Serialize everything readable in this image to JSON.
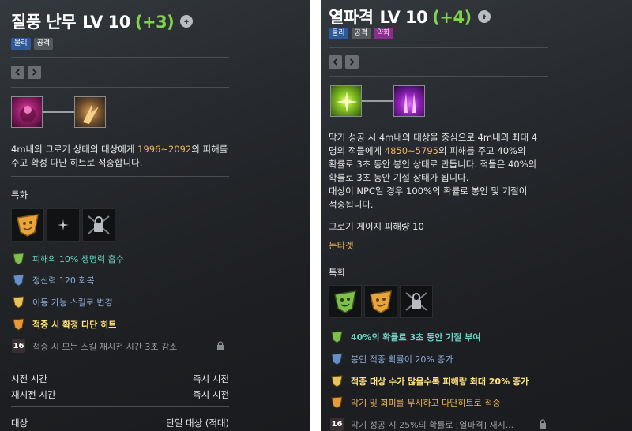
{
  "colors": {
    "accent_orange": "#f0b457",
    "bonus_green": "#7fd34f",
    "effect_cyan": "#6fd1c4",
    "effect_blue": "#8ea9d6",
    "effect_yellow": "#ffe27a",
    "effect_orange": "#f0b457"
  },
  "left": {
    "title": "질풍 난무",
    "level": "LV 10",
    "bonus": "(+3)",
    "tags": [
      "물리",
      "공격"
    ],
    "tripod_icons": [
      "crimson-skill-icon",
      "golden-flurry-icon"
    ],
    "desc": {
      "l1_pre": "4m내의 그로기 상태의 대상에게 ",
      "l1_val": "1996~2092",
      "l1_post": "의 피해를",
      "l2": "주고 확정 다단 히트로 적중합니다."
    },
    "spec_label": "특화",
    "gems": [
      "golden-mask-gem-icon",
      "sparkle-slot-icon",
      "locked-slot-icon"
    ],
    "effects": [
      {
        "text": "피해의 10% 생명력 흡수",
        "icon": "green-tier-icon"
      },
      {
        "text": "정신력 120 회복",
        "icon": "blue-tier-icon"
      },
      {
        "text": "이동 가능 스킬로 변경",
        "icon": "yellow-tier-icon"
      },
      {
        "text": "적중 시 확정 다단 히트",
        "icon": "orange-tier-icon"
      },
      {
        "text": "적중 시 모든 스킬 재시전 시간 3초 감소",
        "badge": "16",
        "locked": true
      }
    ],
    "stats": [
      {
        "label": "시전 시간",
        "value": "즉시 시전"
      },
      {
        "label": "재시전 시간",
        "value": "즉시 시전"
      },
      {
        "label": "대상",
        "value": "단일 대상 (적대)"
      }
    ]
  },
  "right": {
    "title": "열파격",
    "level": "LV 10",
    "bonus": "(+4)",
    "tags": [
      "물리",
      "공격",
      "약화"
    ],
    "tripod_icons": [
      "green-burst-icon",
      "purple-pillar-icon"
    ],
    "desc": {
      "l1": "막기 성공 시 4m내의 대상을 중심으로 4m내의 최대 4",
      "l2_pre": "명의 적들에게 ",
      "l2_val": "4850~5795",
      "l2_post": "의 피해를 주고 40%의",
      "l3": "확률로 3초 동안 봉인 상태로 만듭니다. 적들은 40%의",
      "l4": "확률로 3초 동안 기절 상태가 됩니다.",
      "l5": "대상이 NPC일 경우 100%의 확률로 봉인 및 기절이",
      "l6": "적중됩니다."
    },
    "groggy": "그로기 게이지 피해량 10",
    "counter": "논타겟",
    "spec_label": "특화",
    "gems": [
      "green-mask-gem-icon",
      "golden-mask-gem-icon",
      "locked-slot-icon"
    ],
    "effects": [
      {
        "text": "40%의 확률로 3초 동안 기절 부여",
        "icon": "green-tier-icon"
      },
      {
        "text": "봉인 적중 확률이 20% 증가",
        "icon": "blue-tier-icon"
      },
      {
        "text": "적중 대상 수가 많을수록 피해량 최대 20% 증가",
        "icon": "yellow-tier-icon"
      },
      {
        "text": "막기 및 회피를 무시하고 다단히트로 적중",
        "icon": "orange-tier-icon"
      },
      {
        "text": "막기 성공 시 25%의 확률로 [열파격] 재시...",
        "badge": "16",
        "locked": true
      }
    ]
  }
}
